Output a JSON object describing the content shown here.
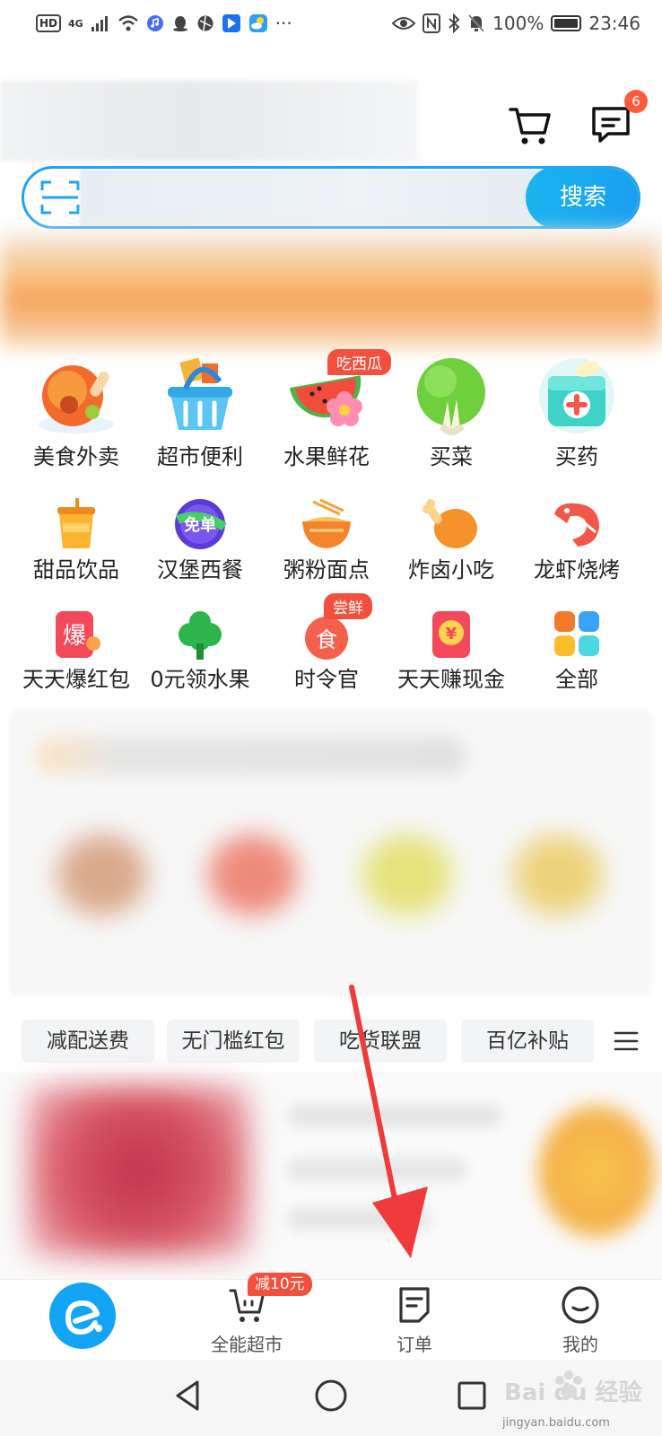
{
  "status_bar": {
    "hd": "HD",
    "network": "4G",
    "more": "···",
    "battery_text": "100%",
    "time": "23:46"
  },
  "header": {
    "message_badge": "6"
  },
  "search": {
    "button_label": "搜索"
  },
  "categories": [
    {
      "label": "美食外卖",
      "icon": "roast-chicken-icon"
    },
    {
      "label": "超市便利",
      "icon": "shopping-basket-icon"
    },
    {
      "label": "水果鲜花",
      "icon": "watermelon-flower-icon",
      "badge": "吃西瓜"
    },
    {
      "label": "买菜",
      "icon": "vegetable-icon"
    },
    {
      "label": "买药",
      "icon": "medicine-box-icon"
    },
    {
      "label": "甜品饮品",
      "icon": "drink-cup-icon"
    },
    {
      "label": "汉堡西餐",
      "icon": "free-order-icon",
      "icon_text": "免单"
    },
    {
      "label": "粥粉面点",
      "icon": "noodle-bowl-icon"
    },
    {
      "label": "炸卤小吃",
      "icon": "drumstick-icon"
    },
    {
      "label": "龙虾烧烤",
      "icon": "shrimp-icon"
    },
    {
      "label": "天天爆红包",
      "icon": "red-packet-icon",
      "icon_text": "爆"
    },
    {
      "label": "0元领水果",
      "icon": "tree-icon"
    },
    {
      "label": "时令官",
      "icon": "seasonal-food-icon",
      "badge": "尝鲜",
      "icon_text": "食"
    },
    {
      "label": "天天赚现金",
      "icon": "cash-envelope-icon",
      "icon_text": "¥"
    },
    {
      "label": "全部",
      "icon": "all-grid-icon"
    }
  ],
  "filters": [
    {
      "label": "减配送费"
    },
    {
      "label": "无门槛红包"
    },
    {
      "label": "吃货联盟"
    },
    {
      "label": "百亿补贴"
    }
  ],
  "tab_bar": {
    "promo": "减10元",
    "tabs": [
      {
        "label": "",
        "icon": "eleme-logo-icon"
      },
      {
        "label": "全能超市",
        "icon": "cart-icon"
      },
      {
        "label": "订单",
        "icon": "order-icon"
      },
      {
        "label": "我的",
        "icon": "profile-icon"
      }
    ]
  },
  "watermark": {
    "logo": "Bai du 经验",
    "url": "jingyan.baidu.com"
  },
  "colors": {
    "accent": "#1fa4ef",
    "badge": "#f24f3c",
    "annotation": "#ef3b3b"
  }
}
